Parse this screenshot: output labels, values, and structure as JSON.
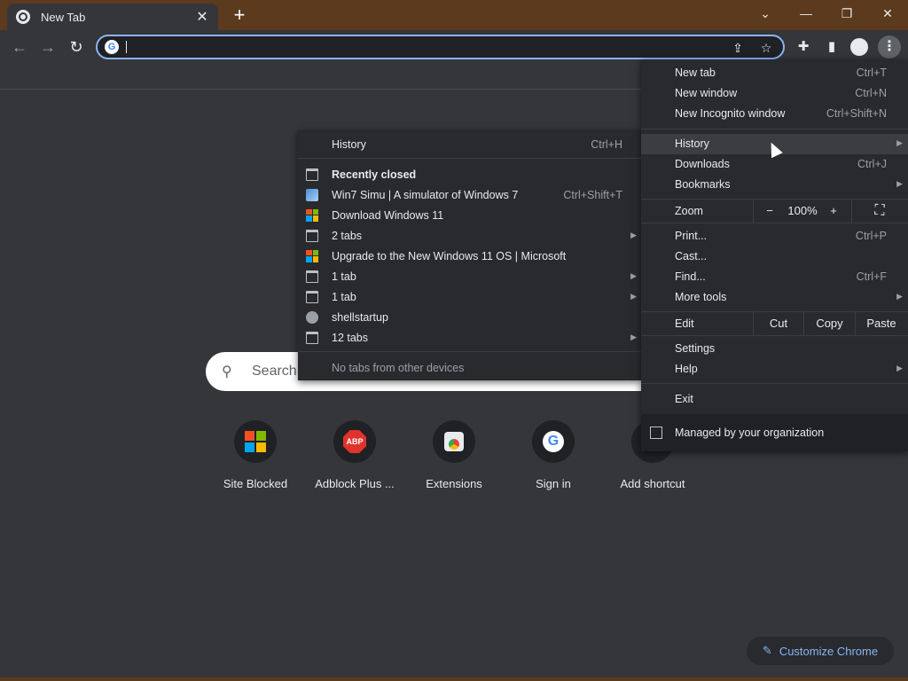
{
  "tabstrip": {
    "tab_title": "New Tab",
    "tab_close": "✕",
    "new_tab": "+",
    "controls": {
      "dropdown": "⌄",
      "minimize": "—",
      "restore": "❐",
      "close": "✕"
    }
  },
  "toolbar": {
    "back": "←",
    "forward": "→",
    "reload": "↻",
    "omnibox_value": "",
    "share": "⇪",
    "star": "☆",
    "extensions": "✚",
    "sidepanel": "▮",
    "menu": "⋮"
  },
  "ntp": {
    "search_placeholder": "Search",
    "shortcuts": [
      {
        "label": "Site Blocked",
        "icon": "microsoft-logo-icon"
      },
      {
        "label": "Adblock Plus ...",
        "icon": "abp-icon",
        "icon_text": "ABP"
      },
      {
        "label": "Extensions",
        "icon": "extensions-icon"
      },
      {
        "label": "Sign in",
        "icon": "google-icon",
        "icon_text": "G"
      },
      {
        "label": "Add shortcut",
        "icon": "add-icon"
      }
    ],
    "customize_label": "Customize Chrome",
    "customize_icon": "✎"
  },
  "history_submenu": {
    "history": {
      "label": "History",
      "shortcut": "Ctrl+H"
    },
    "recently_closed": "Recently closed",
    "items": [
      {
        "label": "Win7 Simu | A simulator of Windows 7",
        "shortcut": "Ctrl+Shift+T",
        "icon": "win7-icon",
        "arrow": false
      },
      {
        "label": "Download Windows 11",
        "shortcut": "",
        "icon": "microsoft-logo-icon",
        "arrow": false
      },
      {
        "label": "2 tabs",
        "shortcut": "",
        "icon": "tab-group-icon",
        "arrow": true
      },
      {
        "label": "Upgrade to the New Windows 11 OS | Microsoft",
        "shortcut": "",
        "icon": "microsoft-logo-icon",
        "arrow": false
      },
      {
        "label": "1 tab",
        "shortcut": "",
        "icon": "tab-group-icon",
        "arrow": true
      },
      {
        "label": "1 tab",
        "shortcut": "",
        "icon": "tab-group-icon",
        "arrow": true
      },
      {
        "label": "shellstartup",
        "shortcut": "",
        "icon": "globe-icon",
        "arrow": false
      },
      {
        "label": "12 tabs",
        "shortcut": "",
        "icon": "tab-group-icon",
        "arrow": true
      }
    ],
    "no_tabs": "No tabs from other devices"
  },
  "main_menu": {
    "new_tab": {
      "label": "New tab",
      "shortcut": "Ctrl+T"
    },
    "new_window": {
      "label": "New window",
      "shortcut": "Ctrl+N"
    },
    "new_incognito": {
      "label": "New Incognito window",
      "shortcut": "Ctrl+Shift+N"
    },
    "history": {
      "label": "History"
    },
    "downloads": {
      "label": "Downloads",
      "shortcut": "Ctrl+J"
    },
    "bookmarks": {
      "label": "Bookmarks"
    },
    "zoom": {
      "label": "Zoom",
      "minus": "−",
      "value": "100%",
      "plus": "+",
      "fullscreen": "⛶"
    },
    "print": {
      "label": "Print...",
      "shortcut": "Ctrl+P"
    },
    "cast": {
      "label": "Cast..."
    },
    "find": {
      "label": "Find...",
      "shortcut": "Ctrl+F"
    },
    "more_tools": {
      "label": "More tools"
    },
    "edit": {
      "label": "Edit",
      "cut": "Cut",
      "copy": "Copy",
      "paste": "Paste"
    },
    "settings": {
      "label": "Settings"
    },
    "help": {
      "label": "Help"
    },
    "exit": {
      "label": "Exit"
    },
    "managed": {
      "label": "Managed by your organization"
    }
  },
  "colors": {
    "frame": "#5c3a1e",
    "background": "#35363a",
    "menu_bg": "#292a2d",
    "accent": "#8ab4f8"
  }
}
